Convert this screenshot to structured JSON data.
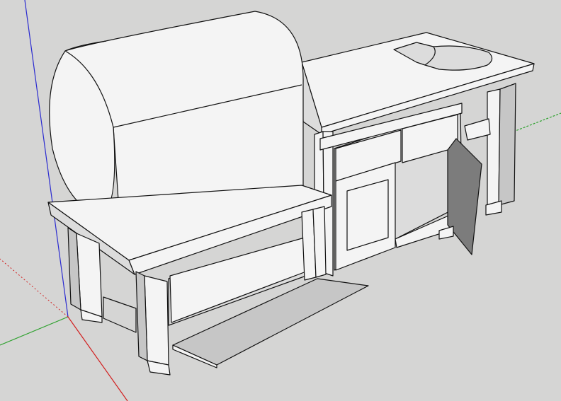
{
  "app": {
    "viewport_kind": "3D modeling viewport (perspective)",
    "background_color": "#d5d5d4"
  },
  "axes": {
    "x_color": "#d22020",
    "y_color": "#22a022",
    "z_color": "#2020c8"
  },
  "model": {
    "primary_face_color": "#f4f4f4",
    "shadow_face_color": "#c6c6c6",
    "dark_panel_color": "#7c7c7c",
    "accent_face_color": "#e0b060",
    "edge_color": "#111111"
  }
}
